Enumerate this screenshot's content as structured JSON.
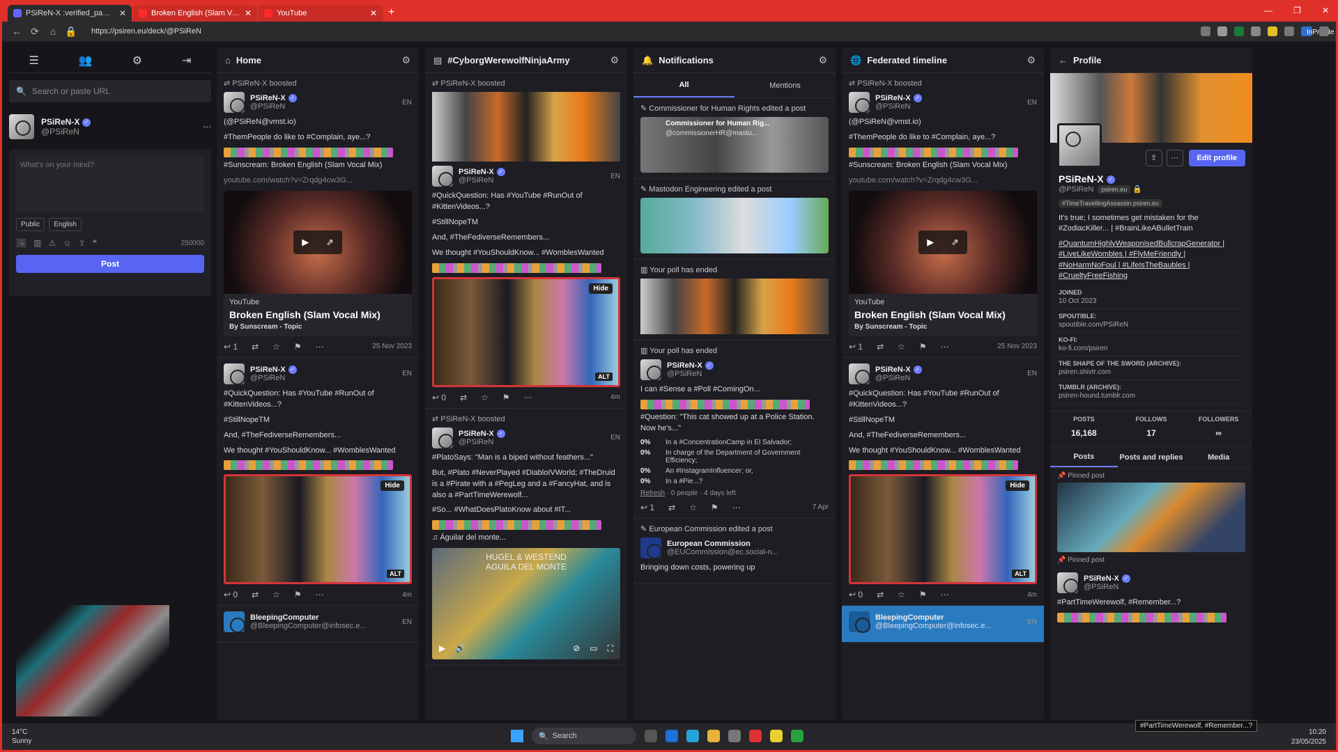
{
  "browser": {
    "tabs": [
      {
        "title": "PSiReN-X :verified_paw: (@PSiReN",
        "active": true
      },
      {
        "title": "Broken English (Slam Vocal M",
        "active": false
      },
      {
        "title": "YouTube",
        "active": false
      }
    ],
    "url": "https://psiren.eu/deck/@PSiReN",
    "inprivate_label": "InPrivate"
  },
  "nav": {
    "search_placeholder": "Search or paste URL",
    "account": {
      "name": "PSiReN-X",
      "handle": "@PSiReN"
    },
    "compose": {
      "placeholder": "What's on your mind?",
      "visibility": "Public",
      "language": "English",
      "char_count": "250000",
      "post_label": "Post"
    }
  },
  "columns": {
    "home": {
      "title": "Home"
    },
    "hashtag": {
      "title": "#CyborgWerewolfNinjaArmy"
    },
    "notifications": {
      "title": "Notifications",
      "tab_all": "All",
      "tab_mentions": "Mentions"
    },
    "federated": {
      "title": "Federated timeline"
    },
    "profile": {
      "title": "Profile"
    }
  },
  "post1": {
    "booster": "PSiReN-X",
    "boosted": "boosted",
    "author": "PSiReN-X",
    "handle": "@PSiReN",
    "lang": "EN",
    "l1": "(@PSiReN@vmst.io)",
    "l2": "#ThemPeople do like to #Complain, aye...?",
    "l3": "#Sunscream: Broken English (Slam Vocal Mix)",
    "link": "youtube.com/watch?v=Zrqdg4cw3G...",
    "card_provider": "YouTube",
    "card_title": "Broken English (Slam Vocal Mix)",
    "card_author": "By Sunscream - Topic",
    "replies": "1",
    "date": "25 Nov 2023"
  },
  "post2": {
    "author": "PSiReN-X",
    "handle": "@PSiReN",
    "lang": "EN",
    "l1": "#QuickQuestion: Has #YouTube #RunOut of #KittenVideos...?",
    "l2": "#StillNopeTM",
    "l3": "And, #TheFediverseRemembers...",
    "l4": "We thought #YouShouldKnow... #WomblesWanted",
    "hide": "Hide",
    "alt": "ALT",
    "replies": "0",
    "time": "4m"
  },
  "post3": {
    "author": "BleepingComputer",
    "handle": "@BleepingComputer@infosec.e...",
    "lang": "EN"
  },
  "post4": {
    "booster": "PSiReN-X",
    "boosted": "boosted",
    "author": "PSiReN-X",
    "handle": "@PSiReN",
    "lang": "EN",
    "l1": "#PlatoSays: \"Man is a biped without feathers...\"",
    "l2": "But, #Plato #NeverPlayed #DiabloIVWorld; #TheDruid is a #Pirate with a #PegLeg and a #FancyHat, and is also a #PartTimeWerewolf...",
    "l3": "#So... #WhatDoesPlatoKnow about #IT...",
    "music": "Águilar del monte...",
    "music_art": "HUGEL & WESTEND\nAGUILA DEL MONTE"
  },
  "notifications": {
    "n1": "Commissioner for Human Rights edited a post",
    "n1_name": "Commissioner for Human Rig...",
    "n1_handle": "@commissionerHR@masto...",
    "n2": "Mastodon Engineering edited a post",
    "n3": "Your poll has ended",
    "n4": "Your poll has ended",
    "poll_author": "PSiReN-X",
    "poll_handle": "@PSiReN",
    "poll_l1": "I can #Sense a #Poll #ComingOn...",
    "poll_q": "#Question: \"This cat showed up at a Police Station. Now he's...\"",
    "options": [
      {
        "pct": "0%",
        "text": "In a #ConcentrationCamp in El Salvador;"
      },
      {
        "pct": "0%",
        "text": "In charge of the Department of Government Efficiency;"
      },
      {
        "pct": "0%",
        "text": "An #InstagramInfluencer; or,"
      },
      {
        "pct": "0%",
        "text": "In a #Pie...?"
      }
    ],
    "refresh": "Refresh",
    "poll_meta": "· 0 people · 4 days left",
    "poll_replies": "1",
    "poll_date": "7 Apr",
    "n5": "European Commission edited a post",
    "ec_name": "European Commission",
    "ec_handle": "@EUCommission@ec.social-n...",
    "ec_text": "Bringing down costs, powering up"
  },
  "profile": {
    "edit_label": "Edit profile",
    "name": "PSiReN-X",
    "handle": "@PSiReN",
    "domain": "psiren.eu",
    "role_badge": "#TimeTravellingAssassin",
    "role_domain": "psiren.eu",
    "bio1": "It's true; I sometimes get mistaken for the #ZodiacKiller... | #BrainLikeABulletTrain",
    "bio2": "#QuantumHighlyWeaponisedBullcrapGenerator | #LiveLikeWombles | #FlyMeFriendly | #NoHarmNoFoul | #LifeIsTheBaubles | #CrueltyFreeFishing",
    "fields": [
      {
        "k": "JOINED",
        "v": "10 Oct 2023"
      },
      {
        "k": "SPOUTIBLE:",
        "v": "spoutible.com/PSiReN"
      },
      {
        "k": "KO-FI:",
        "v": "ko-fi.com/psiren"
      },
      {
        "k": "THE SHAPE OF THE SWORD (ARCHIVE):",
        "v": "psiren.shivtr.com"
      },
      {
        "k": "TUMBLR (ARCHIVE):",
        "v": "psiren-hound.tumblr.com"
      }
    ],
    "stats": [
      {
        "k": "POSTS",
        "v": "16,168"
      },
      {
        "k": "FOLLOWS",
        "v": "17"
      },
      {
        "k": "FOLLOWERS",
        "v": "∞"
      }
    ],
    "tabs": [
      "Posts",
      "Posts and replies",
      "Media"
    ],
    "pinned": "Pinned post",
    "pin_author": "PSiReN-X",
    "pin_handle": "@PSiReN",
    "pin_text": "#PartTimeWerewolf, #Remember...?",
    "tooltip": "#PartTimeWerewolf, #Remember...?"
  },
  "taskbar": {
    "temp": "14°C",
    "weather": "Sunny",
    "search": "Search",
    "time": "10:20",
    "date": "23/05/2025"
  },
  "colors": {
    "accent": "#5865f2",
    "border": "#e0302a",
    "bg": "#16161a"
  }
}
